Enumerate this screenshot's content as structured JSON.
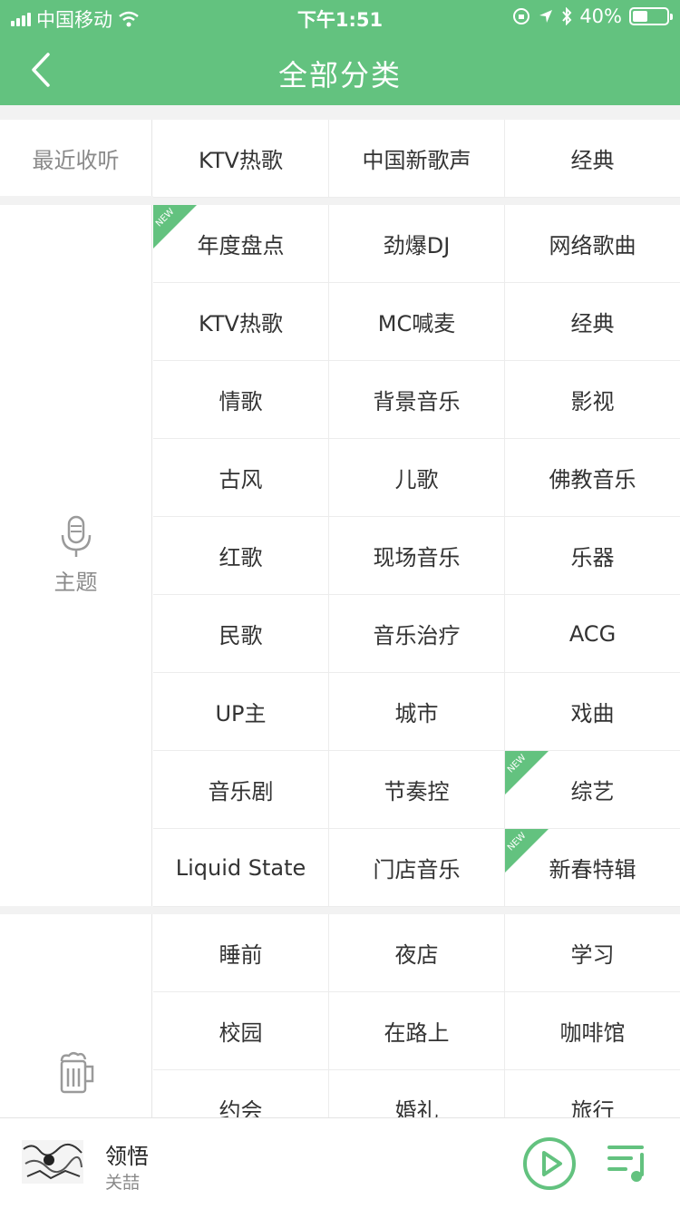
{
  "status_bar": {
    "carrier": "中国移动",
    "time": "下午1:51",
    "battery": "40%"
  },
  "header": {
    "title": "全部分类"
  },
  "recent": {
    "label": "最近收听",
    "items": [
      "KTV热歌",
      "中国新歌声",
      "经典"
    ]
  },
  "theme": {
    "label": "主题",
    "items": [
      {
        "label": "年度盘点",
        "badge": "NEW"
      },
      {
        "label": "劲爆DJ"
      },
      {
        "label": "网络歌曲"
      },
      {
        "label": "KTV热歌"
      },
      {
        "label": "MC喊麦"
      },
      {
        "label": "经典"
      },
      {
        "label": "情歌"
      },
      {
        "label": "背景音乐"
      },
      {
        "label": "影视"
      },
      {
        "label": "古风"
      },
      {
        "label": "儿歌"
      },
      {
        "label": "佛教音乐"
      },
      {
        "label": "红歌"
      },
      {
        "label": "现场音乐"
      },
      {
        "label": "乐器"
      },
      {
        "label": "民歌"
      },
      {
        "label": "音乐治疗"
      },
      {
        "label": "ACG"
      },
      {
        "label": "UP主"
      },
      {
        "label": "城市"
      },
      {
        "label": "戏曲"
      },
      {
        "label": "音乐剧"
      },
      {
        "label": "节奏控"
      },
      {
        "label": "综艺",
        "badge": "NEW"
      },
      {
        "label": "Liquid State"
      },
      {
        "label": "门店音乐"
      },
      {
        "label": "新春特辑",
        "badge": "NEW"
      }
    ]
  },
  "scene": {
    "label": "",
    "items": [
      {
        "label": "睡前"
      },
      {
        "label": "夜店"
      },
      {
        "label": "学习"
      },
      {
        "label": "校园"
      },
      {
        "label": "在路上"
      },
      {
        "label": "咖啡馆"
      },
      {
        "label": "约会"
      },
      {
        "label": "婚礼"
      },
      {
        "label": "旅行"
      }
    ]
  },
  "player": {
    "song": "领悟",
    "artist": "关喆"
  },
  "colors": {
    "accent": "#63c27f"
  },
  "icons": [
    "back-arrow-icon",
    "microphone-icon",
    "beer-mug-icon",
    "play-circle-icon",
    "playlist-icon"
  ]
}
